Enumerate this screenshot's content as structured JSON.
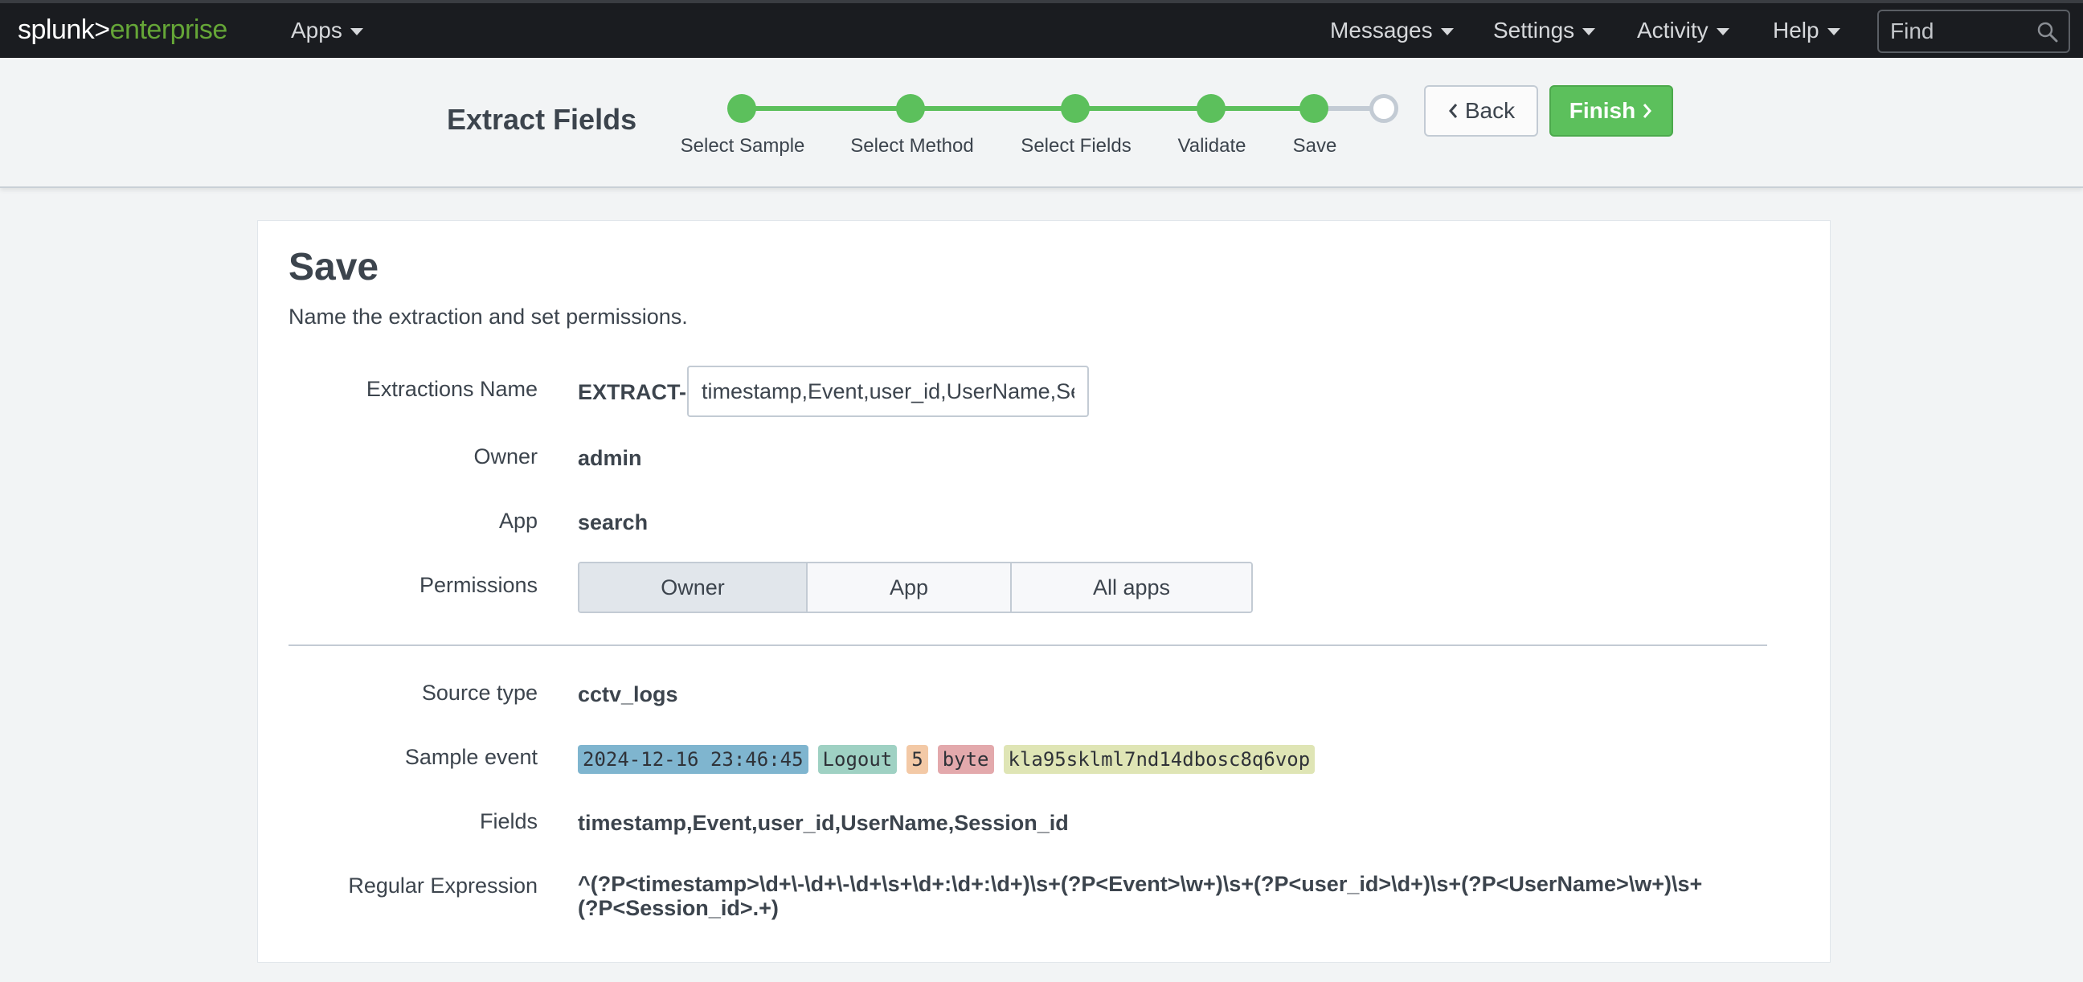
{
  "topbar": {
    "logo_part1": "splunk>",
    "logo_part2": "enterprise",
    "nav_left": [
      {
        "label": "Apps"
      }
    ],
    "nav_right": [
      {
        "label": "Messages"
      },
      {
        "label": "Settings"
      },
      {
        "label": "Activity"
      },
      {
        "label": "Help"
      }
    ],
    "find_placeholder": "Find"
  },
  "wizard": {
    "title": "Extract Fields",
    "steps": [
      {
        "label": "Select Sample",
        "done": true
      },
      {
        "label": "Select Method",
        "done": true
      },
      {
        "label": "Select Fields",
        "done": true
      },
      {
        "label": "Validate",
        "done": true
      },
      {
        "label": "Save",
        "done": true
      },
      {
        "label": "",
        "done": false
      }
    ],
    "back_label": "Back",
    "finish_label": "Finish"
  },
  "form": {
    "title": "Save",
    "subtitle": "Name the extraction and set permissions.",
    "extractions_name_label": "Extractions Name",
    "extract_prefix": "EXTRACT-",
    "extractions_name_value": "timestamp,Event,user_id,UserName,Session_id",
    "owner_label": "Owner",
    "owner_value": "admin",
    "app_label": "App",
    "app_value": "search",
    "permissions_label": "Permissions",
    "permissions_options": [
      "Owner",
      "App",
      "All apps"
    ],
    "permissions_selected": "Owner",
    "source_type_label": "Source type",
    "source_type_value": "cctv_logs",
    "sample_event_label": "Sample event",
    "sample_event_tokens": [
      {
        "text": "2024-12-16 23:46:45",
        "color": "#7fb5cf"
      },
      {
        "text": "Logout",
        "color": "#9fd1c3"
      },
      {
        "text": "5",
        "color": "#f3c9a6"
      },
      {
        "text": "byte",
        "color": "#e3a9ac"
      },
      {
        "text": "kla95sklml7nd14dbosc8q6vop",
        "color": "#dfe5b5"
      }
    ],
    "fields_label": "Fields",
    "fields_value": "timestamp,Event,user_id,UserName,Session_id",
    "regex_label": "Regular Expression",
    "regex_value": "^(?P<timestamp>\\d+\\-\\d+\\-\\d+\\s+\\d+:\\d+:\\d+)\\s+(?P<Event>\\w+)\\s+(?P<user_id>\\d+)\\s+(?P<UserName>\\w+)\\s+(?P<Session_id>.+)"
  },
  "colors": {
    "accent_green": "#5cc05c",
    "topbar_bg": "#1a1c20",
    "logo_green": "#65a637"
  }
}
